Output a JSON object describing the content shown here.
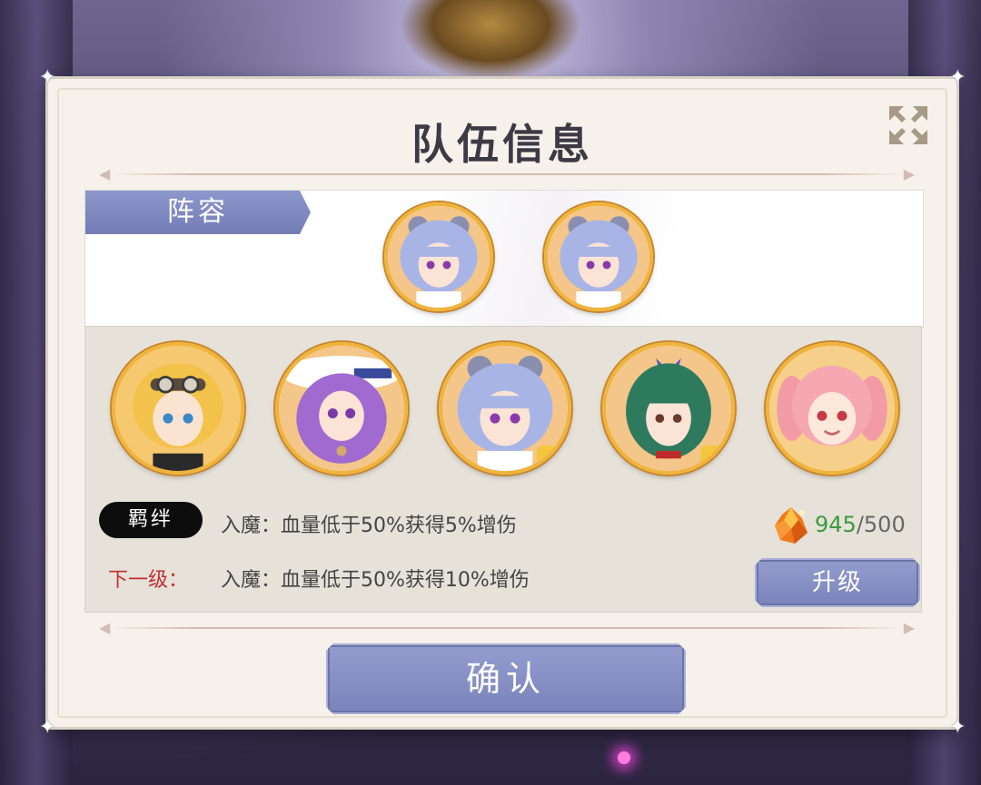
{
  "dialog": {
    "title": "队伍信息",
    "close_icon": "close-arrows-icon"
  },
  "lineup": {
    "tab_label": "阵容",
    "selected": [
      {
        "character": "blue-hair-mouse-ears-girl"
      },
      {
        "character": "blue-hair-mouse-ears-girl"
      }
    ]
  },
  "roster": [
    {
      "character": "blonde-goggles-girl",
      "selected": false
    },
    {
      "character": "purple-hair-white-hat-girl",
      "selected": false
    },
    {
      "character": "blue-hair-mouse-ears-girl",
      "selected": true
    },
    {
      "character": "green-ponytail-girl",
      "selected": true
    },
    {
      "character": "pink-hair-twin-tails-girl",
      "selected": false
    }
  ],
  "bond": {
    "label": "羁绊",
    "current_effect": "入魔：血量低于50%获得5%增伤",
    "next_label": "下一级：",
    "next_effect": "入魔：血量低于50%获得10%增伤"
  },
  "resource": {
    "icon": "orange-crystal-icon",
    "have": "945",
    "need": "/500"
  },
  "buttons": {
    "upgrade": "升级",
    "confirm": "确认"
  },
  "colors": {
    "accent_button": "#7b84ba",
    "portrait_frame": "#f0b43c",
    "next_label": "#c03030",
    "resource_have": "#3c9a3c"
  }
}
